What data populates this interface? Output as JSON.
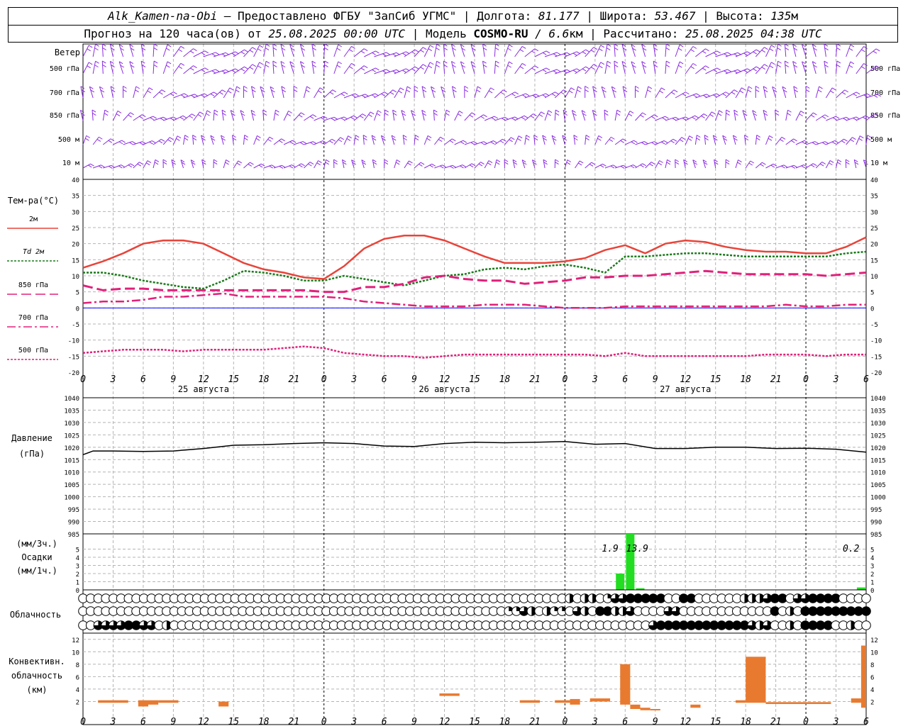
{
  "header": {
    "station": "Alk_Kamen-na-Obi",
    "provider": " – Предоставлено ФГБУ \"ЗапСиб УГМС\" | Долгота: ",
    "lon": "81.177",
    "lat_label": " | Широта: ",
    "lat": "53.467",
    "alt_label": " | Высота: ",
    "alt": "135",
    "alt_unit": "м",
    "forecast_label": "Прогноз на 120 часа(ов) от ",
    "forecast_from": "25.08.2025 00:00 UTC",
    "model_label": " | Модель ",
    "model": "COSMO-RU",
    "resolution": " / 6.6",
    "resolution_unit": "км",
    "calc_label": " | Рассчитано: ",
    "calc_time": "25.08.2025 04:38 UTC"
  },
  "colors": {
    "wind": "#8a2be2",
    "t2m": "#e8443a",
    "td2m": "#1a7a1a",
    "t850": "#e0207a",
    "t700": "#e0207a",
    "t500": "#e0207a",
    "zero_line": "#0000ff",
    "pressure": "#000000",
    "precip": "#22dd22",
    "convective": "#e87a30"
  },
  "time_axis": {
    "hour_labels": [
      "0",
      "3",
      "6",
      "9",
      "12",
      "15",
      "18",
      "21",
      "0",
      "3",
      "6",
      "9",
      "12",
      "15",
      "18",
      "21",
      "0",
      "3",
      "6",
      "9",
      "12",
      "15",
      "18",
      "21",
      "0",
      "3",
      "6"
    ],
    "day_labels": [
      "25 августа",
      "26 августа",
      "27 августа"
    ],
    "day_label_hours": [
      12,
      36,
      60
    ]
  },
  "wind_panel": {
    "label": "Ветер",
    "levels": [
      "500 гПа",
      "700 гПа",
      "850 гПа",
      "500 м",
      "10  м"
    ]
  },
  "chart_data": [
    {
      "id": "temperature",
      "type": "line",
      "title": "",
      "ylabel": "Тем-ра(°С)",
      "ylim": [
        -20,
        40
      ],
      "yticks": [
        40,
        35,
        30,
        25,
        20,
        15,
        10,
        5,
        0,
        -5,
        -10,
        -15,
        -20
      ],
      "grid": true,
      "legend_position": "left",
      "series": [
        {
          "name": "2м",
          "style": "solid",
          "x": [
            0,
            2,
            4,
            6,
            8,
            10,
            12,
            14,
            16,
            18,
            20,
            22,
            24,
            26,
            28,
            30,
            32,
            34,
            36,
            38,
            40,
            42,
            44,
            46,
            48,
            50,
            52,
            54,
            56,
            58,
            60,
            62,
            64,
            66,
            68,
            70,
            72,
            74,
            76,
            78
          ],
          "y": [
            12.5,
            14.5,
            17,
            20,
            21,
            21,
            20,
            17,
            14,
            12,
            11,
            9.5,
            9,
            13,
            18.5,
            21.5,
            22.5,
            22.5,
            21,
            18.5,
            16,
            14,
            14,
            14,
            14.5,
            15.5,
            18,
            19.5,
            17,
            20,
            21,
            20.5,
            19,
            18,
            17.5,
            17.5,
            17,
            17,
            19,
            22
          ]
        },
        {
          "name": "Td  2м",
          "style": "dotted",
          "x": [
            0,
            2,
            4,
            6,
            8,
            10,
            12,
            14,
            16,
            18,
            20,
            22,
            24,
            26,
            28,
            30,
            32,
            34,
            36,
            38,
            40,
            42,
            44,
            46,
            48,
            50,
            52,
            54,
            56,
            58,
            60,
            62,
            64,
            66,
            68,
            70,
            72,
            74,
            76,
            78
          ],
          "y": [
            11,
            11,
            10,
            8.5,
            7.5,
            6.5,
            6,
            8.5,
            11.5,
            11,
            10,
            8.5,
            8.5,
            10,
            9,
            8,
            7,
            8.5,
            10,
            10.5,
            12,
            12.5,
            12,
            13,
            13.5,
            12.5,
            11,
            16,
            16,
            16.5,
            17,
            17,
            16.5,
            16,
            16,
            16,
            16,
            16,
            17,
            17.5
          ]
        },
        {
          "name": "850 гПа",
          "style": "dashed-long",
          "x": [
            0,
            2,
            4,
            6,
            8,
            10,
            12,
            14,
            16,
            18,
            20,
            22,
            24,
            26,
            28,
            30,
            32,
            34,
            36,
            38,
            40,
            42,
            44,
            46,
            48,
            50,
            52,
            54,
            56,
            58,
            60,
            62,
            64,
            66,
            68,
            70,
            72,
            74,
            76,
            78
          ],
          "y": [
            7,
            5.5,
            6,
            6,
            5.5,
            5.5,
            5.5,
            5.5,
            5.5,
            5.5,
            5.5,
            5.5,
            5,
            5,
            6.5,
            6.5,
            7.5,
            9.5,
            10,
            9,
            8.5,
            8.5,
            7.5,
            8,
            8.5,
            9.5,
            9.5,
            10,
            10,
            10.5,
            11,
            11.5,
            11,
            10.5,
            10.5,
            10.5,
            10.5,
            10,
            10.5,
            11
          ]
        },
        {
          "name": "700 гПа",
          "style": "dash-dot",
          "x": [
            0,
            2,
            4,
            6,
            8,
            10,
            12,
            14,
            16,
            18,
            20,
            22,
            24,
            26,
            28,
            30,
            32,
            34,
            36,
            38,
            40,
            42,
            44,
            46,
            48,
            50,
            52,
            54,
            56,
            58,
            60,
            62,
            64,
            66,
            68,
            70,
            72,
            74,
            76,
            78
          ],
          "y": [
            1.5,
            2,
            2,
            2.5,
            3.5,
            3.5,
            4,
            4.5,
            3.5,
            3.5,
            3.5,
            3.5,
            3.5,
            3,
            2,
            1.5,
            1,
            0.5,
            0.5,
            0.5,
            1,
            1,
            1,
            0.5,
            0,
            0,
            0,
            0.5,
            0.5,
            0.5,
            0.5,
            0.5,
            0.5,
            0.5,
            0.5,
            1,
            0.5,
            0.5,
            1,
            1
          ]
        },
        {
          "name": "500 гПа",
          "style": "dotted-fine",
          "x": [
            0,
            2,
            4,
            6,
            8,
            10,
            12,
            14,
            16,
            18,
            20,
            22,
            24,
            26,
            28,
            30,
            32,
            34,
            36,
            38,
            40,
            42,
            44,
            46,
            48,
            50,
            52,
            54,
            56,
            58,
            60,
            62,
            64,
            66,
            68,
            70,
            72,
            74,
            76,
            78
          ],
          "y": [
            -14,
            -13.5,
            -13,
            -13,
            -13,
            -13.5,
            -13,
            -13,
            -13,
            -13,
            -12.5,
            -12,
            -12.5,
            -14,
            -14.5,
            -15,
            -15,
            -15.5,
            -15,
            -14.5,
            -14.5,
            -14.5,
            -14.5,
            -14.5,
            -14.5,
            -14.5,
            -15,
            -14,
            -15,
            -15,
            -15,
            -15,
            -15,
            -15,
            -14.5,
            -14.5,
            -14.5,
            -15,
            -14.5,
            -14.5
          ]
        }
      ]
    },
    {
      "id": "pressure",
      "type": "line",
      "title": "",
      "ylabel": "Давление",
      "yunit": "(гПа)",
      "ylim": [
        985,
        1040
      ],
      "yticks": [
        1040,
        1035,
        1030,
        1025,
        1020,
        1015,
        1010,
        1005,
        1000,
        995,
        990,
        985
      ],
      "grid": true,
      "series": [
        {
          "name": "",
          "style": "solid",
          "x": [
            0,
            1,
            3,
            6,
            9,
            12,
            15,
            18,
            21,
            24,
            27,
            30,
            33,
            36,
            39,
            42,
            45,
            48,
            51,
            54,
            57,
            60,
            63,
            66,
            69,
            72,
            75,
            78
          ],
          "y": [
            1017,
            1018.5,
            1018.5,
            1018.3,
            1018.5,
            1019.5,
            1020.8,
            1021,
            1021.5,
            1021.8,
            1021.5,
            1020.5,
            1020.3,
            1021.5,
            1022,
            1021.8,
            1022,
            1022.3,
            1021.2,
            1021.5,
            1019.5,
            1019.5,
            1020,
            1020,
            1019.5,
            1019.6,
            1019.2,
            1018
          ]
        }
      ]
    },
    {
      "id": "precipitation",
      "type": "bar",
      "title": "",
      "ylabel": "Осадки",
      "yunit_top": "(мм/3ч.)",
      "yunit_bottom": "(мм/1ч.)",
      "ylim": [
        0,
        6
      ],
      "yticks": [
        5,
        4,
        3,
        2,
        1,
        0
      ],
      "grid": true,
      "x": [
        53.5,
        54.5,
        55.5,
        77.5
      ],
      "values": [
        2,
        13.9,
        0.2,
        0.3
      ],
      "data_labels": [
        {
          "x": 52.5,
          "text": "1.9"
        },
        {
          "x": 55.2,
          "text": "13.9"
        },
        {
          "x": 76.5,
          "text": "0.2"
        }
      ]
    },
    {
      "id": "convective_cloud",
      "type": "bar",
      "title": "",
      "ylabel": "Конвективн.",
      "ylabel2": "облачность",
      "yunit": "(км)",
      "ylim": [
        0,
        13
      ],
      "yticks": [
        12,
        10,
        8,
        6,
        4,
        2
      ],
      "grid": true,
      "bars": [
        {
          "x0": 1.5,
          "x1": 4.5,
          "bottom": 1.8,
          "top": 2.2
        },
        {
          "x0": 5.5,
          "x1": 6.5,
          "bottom": 1.2,
          "top": 2.2
        },
        {
          "x0": 6.5,
          "x1": 7.5,
          "bottom": 1.5,
          "top": 2.2
        },
        {
          "x0": 7.5,
          "x1": 9.5,
          "bottom": 1.8,
          "top": 2.2
        },
        {
          "x0": 13.5,
          "x1": 14.5,
          "bottom": 1.2,
          "top": 2.0
        },
        {
          "x0": 35.5,
          "x1": 37.5,
          "bottom": 2.9,
          "top": 3.3
        },
        {
          "x0": 43.5,
          "x1": 45.5,
          "bottom": 1.8,
          "top": 2.2
        },
        {
          "x0": 47.0,
          "x1": 48.5,
          "bottom": 1.8,
          "top": 2.2
        },
        {
          "x0": 48.5,
          "x1": 49.5,
          "bottom": 1.5,
          "top": 2.4
        },
        {
          "x0": 50.5,
          "x1": 52.5,
          "bottom": 2.0,
          "top": 2.5
        },
        {
          "x0": 53.5,
          "x1": 54.5,
          "bottom": 1.5,
          "top": 8
        },
        {
          "x0": 54.5,
          "x1": 55.5,
          "bottom": 0.8,
          "top": 1.5
        },
        {
          "x0": 55.5,
          "x1": 56.5,
          "bottom": 0.6,
          "top": 1.0
        },
        {
          "x0": 56.5,
          "x1": 57.5,
          "bottom": 0.6,
          "top": 0.8
        },
        {
          "x0": 60.5,
          "x1": 61.5,
          "bottom": 1.0,
          "top": 1.5
        },
        {
          "x0": 65.0,
          "x1": 66.0,
          "bottom": 1.8,
          "top": 2.2
        },
        {
          "x0": 66.0,
          "x1": 68.0,
          "bottom": 1.8,
          "top": 9.2
        },
        {
          "x0": 68.0,
          "x1": 74.5,
          "bottom": 1.6,
          "top": 1.9
        },
        {
          "x0": 76.5,
          "x1": 77.5,
          "bottom": 1.8,
          "top": 2.5
        },
        {
          "x0": 77.5,
          "x1": 78.0,
          "bottom": 1.0,
          "top": 11
        }
      ]
    }
  ],
  "cloud_panel": {
    "label": "Облачность",
    "rows": [
      "00000000000000000000000000000000000000000000000000000000000000002022013344444004400000022234403344440000",
      "00000000000000000000000000000000000000000000000000000000113202110320442230000330000000000004020444444444",
      "00333344330200000000000000000000000000000000000000000000000000000000000000034444444444443230020444400200"
    ]
  }
}
